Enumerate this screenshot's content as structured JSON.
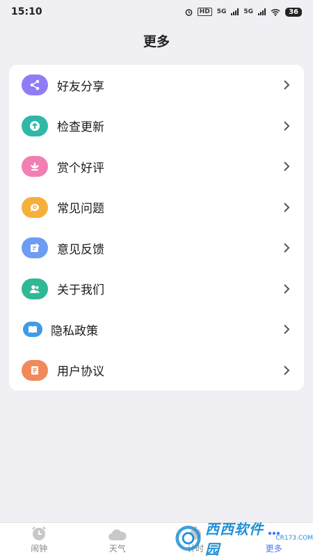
{
  "status_bar": {
    "time": "15:10",
    "net_label": "HD",
    "signal_1": "5G",
    "signal_2": "5G",
    "battery": "36"
  },
  "header": {
    "title": "更多"
  },
  "menu": [
    {
      "label": "好友分享",
      "icon": "share-icon",
      "color": "#8f7cf6"
    },
    {
      "label": "检查更新",
      "icon": "upload-icon",
      "color": "#2fb8a8"
    },
    {
      "label": "赏个好评",
      "icon": "lotus-icon",
      "color": "#f27fb4"
    },
    {
      "label": "常见问题",
      "icon": "question-bubble-icon",
      "color": "#f5b03c"
    },
    {
      "label": "意见反馈",
      "icon": "feedback-icon",
      "color": "#6c9cf3"
    },
    {
      "label": "关于我们",
      "icon": "people-icon",
      "color": "#2fb894"
    },
    {
      "label": "隐私政策",
      "icon": "book-icon",
      "color": "#3f9be8"
    },
    {
      "label": "用户协议",
      "icon": "document-icon",
      "color": "#f08a5a"
    }
  ],
  "tabbar": {
    "tabs": [
      {
        "label": "闹钟",
        "icon": "alarm-clock-icon"
      },
      {
        "label": "天气",
        "icon": "cloud-icon"
      },
      {
        "label": "计时",
        "icon": "timer-icon"
      },
      {
        "label": "更多",
        "icon": "more-icon"
      }
    ],
    "active": "更多",
    "active_color": "#4a78ff"
  },
  "watermark": {
    "text": "西西软件园",
    "sub": "CR173.COM"
  }
}
